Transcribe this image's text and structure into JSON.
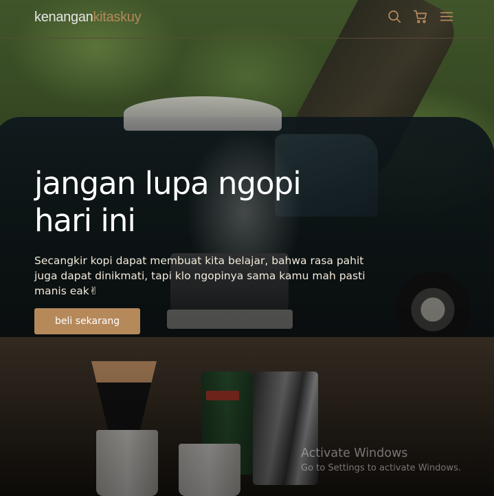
{
  "nav": {
    "logo_part1": "kenangan",
    "logo_part2": "kitaskuy",
    "icons": [
      "search-icon",
      "cart-icon",
      "menu-icon"
    ]
  },
  "hero": {
    "title_line1": "jangan lupa ngopi",
    "title_line2": "hari ini",
    "text": "Secangkir kopi dapat membuat kita belajar, bahwa rasa pahit juga dapat dinikmati, tapi klo ngopinya sama kamu mah pasti manis eak✌",
    "cta_label": "beli sekarang"
  },
  "watermark": {
    "title": "Activate Windows",
    "subtitle": "Go to Settings to activate Windows."
  },
  "colors": {
    "accent": "#b6895b",
    "text_light": "#ffffff",
    "paragraph": "#f3eadb"
  }
}
